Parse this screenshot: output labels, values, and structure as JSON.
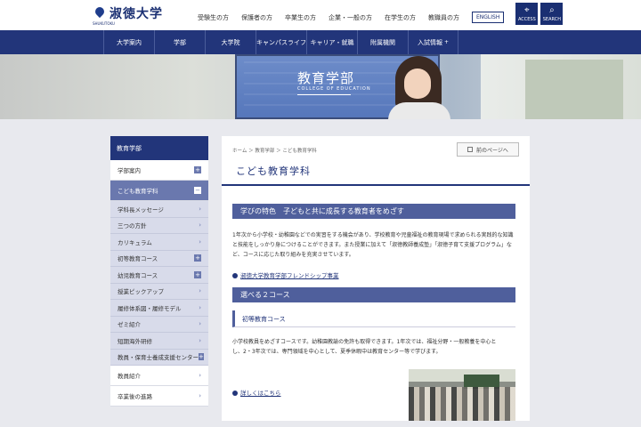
{
  "header": {
    "logo_text": "淑徳大学",
    "logo_sub": "SHUKUTOKU",
    "links": [
      "受験生の方",
      "保護者の方",
      "卒業生の方",
      "企業・一般の方",
      "在学生の方",
      "教職員の方"
    ],
    "english": "ENGLISH",
    "access": "ACCESS",
    "search": "SEARCH"
  },
  "mainnav": {
    "items": [
      "大学案内",
      "学部",
      "大学院",
      "キャンパスライフ",
      "キャリア・就職",
      "附属機関",
      "入試情報"
    ]
  },
  "hero": {
    "title": "教育学部",
    "subtitle": "COLLEGE OF EDUCATION"
  },
  "sidebar": {
    "title": "教育学部",
    "items": [
      {
        "label": "学部案内",
        "type": "plus"
      },
      {
        "label": "こども教育学科",
        "type": "minus"
      },
      {
        "label": "学科長メッセージ",
        "type": "chev"
      },
      {
        "label": "三つの方針",
        "type": "chev"
      },
      {
        "label": "カリキュラム",
        "type": "chev"
      },
      {
        "label": "初等教育コース",
        "type": "plus"
      },
      {
        "label": "幼児教育コース",
        "type": "plus"
      },
      {
        "label": "授業ピックアップ",
        "type": "chev"
      },
      {
        "label": "履修体系図・履修モデル",
        "type": "chev"
      },
      {
        "label": "ゼミ紹介",
        "type": "chev"
      },
      {
        "label": "短期海外研修",
        "type": "chev"
      },
      {
        "label": "教員・保育士養成支援センター",
        "type": "plus"
      },
      {
        "label": "教員紹介",
        "type": "chev"
      },
      {
        "label": "卒業後の進路",
        "type": "chev"
      }
    ]
  },
  "content": {
    "breadcrumb": "ホーム ＞ 教育学部 ＞ こども教育学科",
    "back": "前のページへ",
    "title": "こども教育学科",
    "section1": "学びの特色　子どもと共に成長する教育者をめざす",
    "para1": "1年次から小学校・幼稚園などでの実習をする機会があり、学校教育や児童福祉の教育現場で求められる実践的な知識と技能をしっかり身につけることができます。また授業に加えて「淑徳教師養成塾」「淑徳子育て支援プログラム」など、コースに応じた取り組みを充実させています。",
    "link1": "淑徳大学教育学部フレンドシップ事業",
    "section2": "選べる２コース",
    "subhead": "初等教育コース",
    "para2": "小学校教員をめざすコースです。幼稚園教諭の免許も取得できます。1年次では、福祉分野・一般教養を中心とし、2・3年次では、専門領域を中心として、夏季休暇中は教育センター等で学びます。",
    "link2": "詳しくはこちら"
  }
}
